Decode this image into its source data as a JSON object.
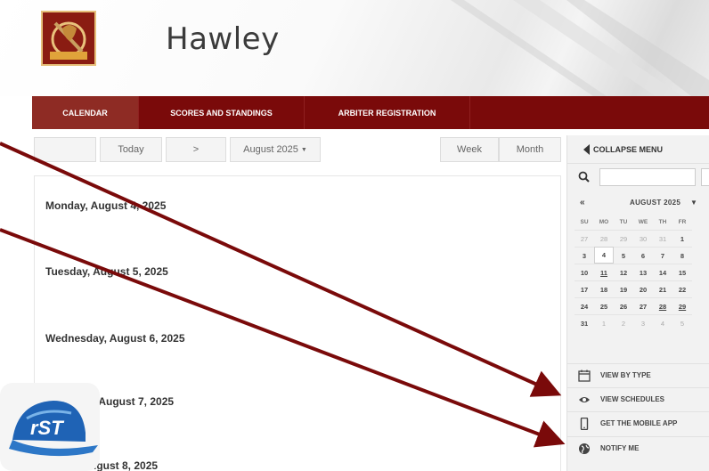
{
  "header": {
    "title": "Hawley",
    "logo_alt": "Rockets logo"
  },
  "nav": {
    "items": [
      {
        "label": "CALENDAR",
        "active": true
      },
      {
        "label": "SCORES AND STANDINGS",
        "active": false
      },
      {
        "label": "ARBITER REGISTRATION",
        "active": false
      }
    ]
  },
  "toolbar": {
    "today_label": "Today",
    "next_label": ">",
    "month_select": "August 2025",
    "week_label": "Week",
    "month_label": "Month"
  },
  "agenda": {
    "days": [
      "Monday, August 4, 2025",
      "Tuesday, August 5, 2025",
      "Wednesday, August 6, 2025",
      "Thursday, August 7, 2025",
      "Friday, August 8, 2025"
    ]
  },
  "side": {
    "collapse_label": "COLLAPSE MENU",
    "search_placeholder": "",
    "mini_cal": {
      "prev": "«",
      "month_label": "AUGUST 2025",
      "dow": [
        "SU",
        "MO",
        "TU",
        "WE",
        "TH",
        "FR"
      ],
      "weeks": [
        [
          "27",
          "28",
          "29",
          "30",
          "31",
          "1"
        ],
        [
          "3",
          "4",
          "5",
          "6",
          "7",
          "8"
        ],
        [
          "10",
          "11",
          "12",
          "13",
          "14",
          "15"
        ],
        [
          "17",
          "18",
          "19",
          "20",
          "21",
          "22"
        ],
        [
          "24",
          "25",
          "26",
          "27",
          "28",
          "29"
        ],
        [
          "31",
          "1",
          "2",
          "3",
          "4",
          "5"
        ]
      ]
    },
    "menu": [
      {
        "label": "VIEW BY TYPE",
        "icon": "calendar-icon"
      },
      {
        "label": "VIEW SCHEDULES",
        "icon": "eye-icon"
      },
      {
        "label": "GET THE MOBILE APP",
        "icon": "phone-icon"
      },
      {
        "label": "NOTIFY ME",
        "icon": "globe-icon"
      }
    ]
  },
  "badge": {
    "text": "rST"
  },
  "colors": {
    "nav_bg": "#7a0a0a",
    "nav_active": "#8e2b24",
    "arrow": "#7a0a0a"
  }
}
